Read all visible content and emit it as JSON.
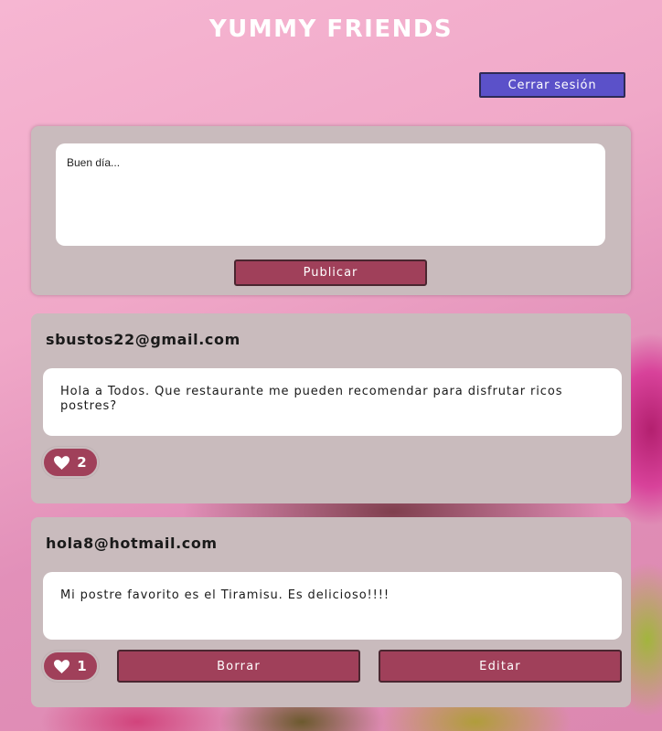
{
  "app": {
    "title": "YUMMY FRIENDS"
  },
  "header": {
    "logout_label": "Cerrar sesión"
  },
  "composer": {
    "value": "Buen día...",
    "publish_label": "Publicar"
  },
  "posts": [
    {
      "author": "sbustos22@gmail.com",
      "text": "Hola a Todos. Que restaurante me pueden recomendar para disfrutar ricos postres?",
      "likes": "2"
    },
    {
      "author": "hola8@hotmail.com",
      "text": "Mi postre favorito es el Tiramisu. Es delicioso!!!!",
      "likes": "1",
      "delete_label": "Borrar",
      "edit_label": "Editar"
    }
  ],
  "icons": {
    "like": "heart-icon"
  },
  "colors": {
    "accent": "#a0405a",
    "logout": "#5b51c9",
    "card": "#c9bbbd"
  }
}
